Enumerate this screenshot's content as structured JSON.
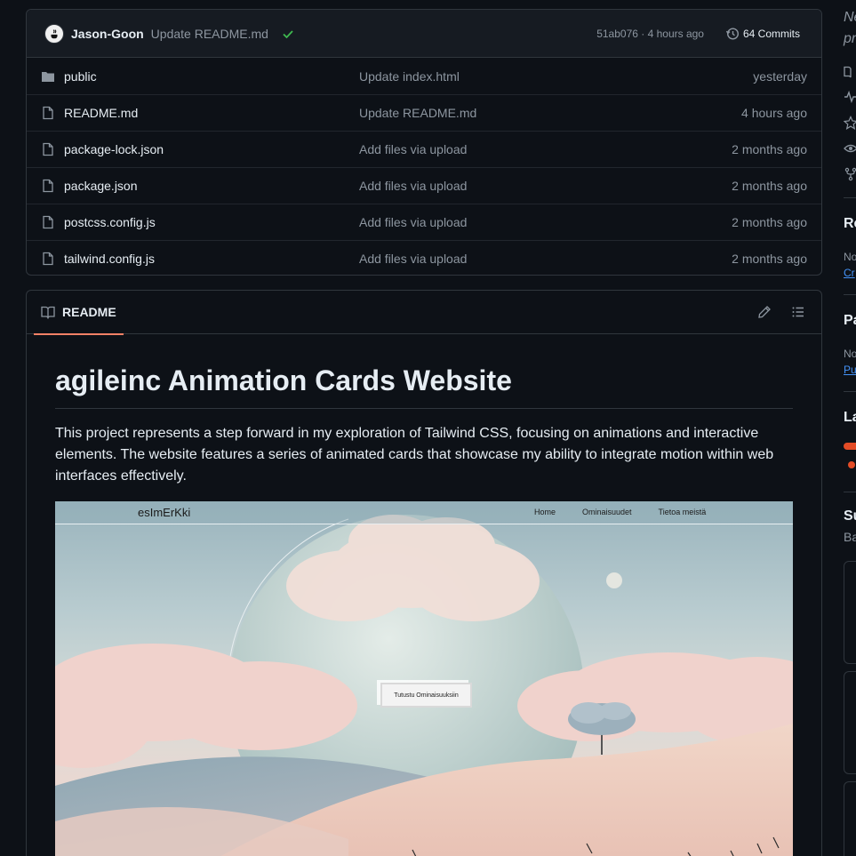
{
  "commit_bar": {
    "author": "Jason-Goon",
    "message": "Update README.md",
    "hash": "51ab076",
    "time": "4 hours ago",
    "commits_label": "64 Commits"
  },
  "files": [
    {
      "name": "public",
      "type": "folder",
      "commit": "Update index.html",
      "age": "yesterday"
    },
    {
      "name": "README.md",
      "type": "file",
      "commit": "Update README.md",
      "age": "4 hours ago"
    },
    {
      "name": "package-lock.json",
      "type": "file",
      "commit": "Add files via upload",
      "age": "2 months ago"
    },
    {
      "name": "package.json",
      "type": "file",
      "commit": "Add files via upload",
      "age": "2 months ago"
    },
    {
      "name": "postcss.config.js",
      "type": "file",
      "commit": "Add files via upload",
      "age": "2 months ago"
    },
    {
      "name": "tailwind.config.js",
      "type": "file",
      "commit": "Add files via upload",
      "age": "2 months ago"
    }
  ],
  "readme": {
    "tab_label": "README",
    "title": "agileinc Animation Cards Website",
    "paragraph": "This project represents a step forward in my exploration of Tailwind CSS, focusing on animations and interactive elements. The website features a series of animated cards that showcase my ability to integrate motion within web interfaces effectively.",
    "preview": {
      "logo": "esImErKki",
      "nav_links": [
        "Home",
        "Ominaisuudet",
        "Tietoa meistä"
      ],
      "cta": "Tutustu Ominaisuuksiin"
    }
  },
  "sidebar": {
    "italic_text": [
      "Ne",
      "pr"
    ],
    "sections": [
      {
        "title": "Re",
        "text": "No",
        "link": "Cr"
      },
      {
        "title": "Pa",
        "text": "No",
        "link": "Pu"
      },
      {
        "title": "La"
      },
      {
        "title": "Su",
        "text": "Ba"
      }
    ]
  },
  "colors": {
    "background": "#0d1117",
    "surface": "#161b22",
    "border": "#30363d",
    "text": "#e6edf3",
    "muted": "#8d96a0",
    "link": "#4493f8",
    "accent": "#f78166",
    "success": "#3fb950"
  },
  "icons": {
    "folder": "folder-icon",
    "file": "file-icon",
    "check": "check-icon",
    "history": "history-icon",
    "book": "book-icon",
    "pencil": "pencil-icon",
    "list": "list-icon"
  }
}
